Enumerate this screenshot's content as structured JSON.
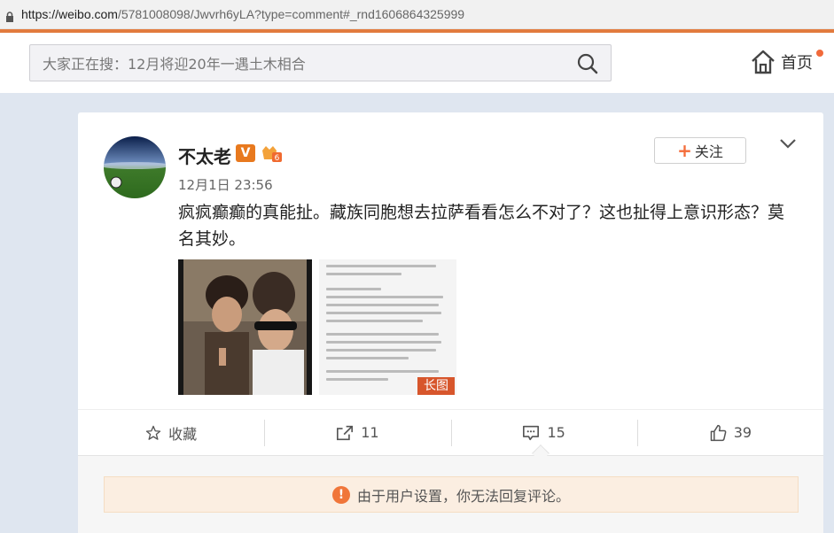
{
  "browser": {
    "url_host": "https://weibo.com",
    "url_rest": "/5781008098/Jwvrh6yLA?type=comment#_rnd1606864325999"
  },
  "nav": {
    "search_placeholder": "大家正在搜：12月将迎20年一遇土木相合",
    "home_label": "首页"
  },
  "post": {
    "author": "不太老",
    "verified_badge": "V",
    "time": "12月1日 23:56",
    "follow_label": "关注",
    "text": "疯疯癫癫的真能扯。藏族同胞想去拉萨看看怎么不对了？这也扯得上意识形态？莫名其妙。",
    "long_image_tag": "长图"
  },
  "actions": {
    "favorite_label": "收藏",
    "repost_count": "11",
    "comment_count": "15",
    "like_count": "39"
  },
  "comments": {
    "notice": "由于用户设置，你无法回复评论。"
  },
  "colors": {
    "accent": "#e27b3e",
    "follow_plus": "#f46d3b",
    "notice_bg": "#fbeee1",
    "warn_icon": "#f0763a"
  }
}
